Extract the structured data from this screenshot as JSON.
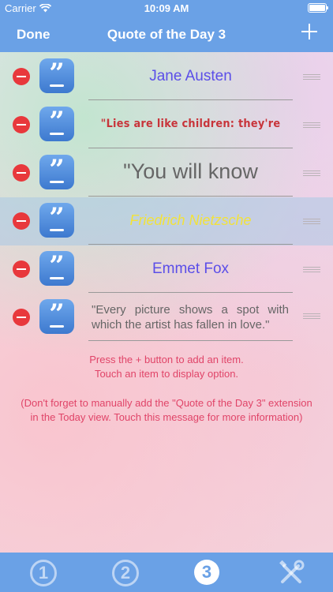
{
  "status_bar": {
    "carrier": "Carrier",
    "time": "10:09 AM"
  },
  "nav": {
    "left": "Done",
    "title": "Quote of the Day 3"
  },
  "rows": [
    {
      "text": "Jane Austen",
      "color": "#5b4ee8",
      "font": "sans 19px"
    },
    {
      "text": "\"Lies are like children: they're",
      "color": "#c8343a",
      "font": "bold condensed"
    },
    {
      "text": "\"You will know",
      "color": "#666666",
      "font": "sans 27px"
    },
    {
      "text": "Friedrich Nietzsche",
      "color": "#f2e23a",
      "font": "italic"
    },
    {
      "text": "Emmet Fox",
      "color": "#5b4ee8",
      "font": "sans 19px"
    },
    {
      "text": "\"Every picture shows a spot with which the artist has fallen in love.\"",
      "color": "#666666",
      "font": "sans 15px"
    }
  ],
  "info": {
    "line1": "Press the + button to add an item.",
    "line2": "Touch an item to display option.",
    "note": "(Don't forget to manually add the \"Quote of the Day 3\" extension in the Today view. Touch this message for more information)"
  },
  "tabs": [
    "1",
    "2",
    "3"
  ],
  "tab_selected": "3",
  "icons": {
    "wifi": "wifi-icon",
    "battery": "battery-icon",
    "add": "plus-icon",
    "delete": "minus-circle-icon",
    "quote": "quote-icon",
    "reorder": "reorder-handle-icon",
    "settings": "tools-icon"
  },
  "colors": {
    "bar": "#6aa1e6",
    "delete": "#e8383c",
    "info_text": "#e04468"
  }
}
